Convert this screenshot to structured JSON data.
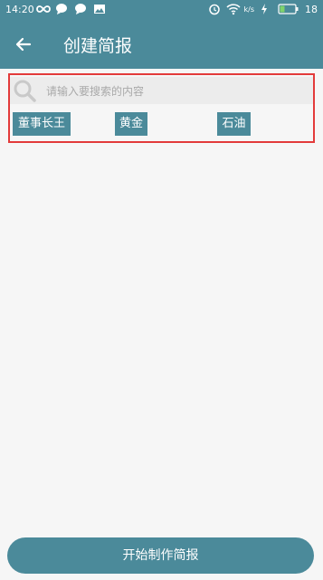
{
  "status_bar": {
    "time": "14:20",
    "battery_level": "18",
    "network_speed": "k/s"
  },
  "app_bar": {
    "title": "创建简报",
    "back_icon": "arrow-left-icon"
  },
  "search": {
    "placeholder": "请输入要搜索的内容",
    "icon": "search-icon"
  },
  "tags": [
    {
      "label": "董事长王"
    },
    {
      "label": "黄金"
    },
    {
      "label": "石油"
    }
  ],
  "footer": {
    "button_label": "开始制作简报"
  },
  "colors": {
    "primary": "#4b8a9a",
    "highlight_border": "#e33b3b",
    "background": "#f6f6f6"
  }
}
